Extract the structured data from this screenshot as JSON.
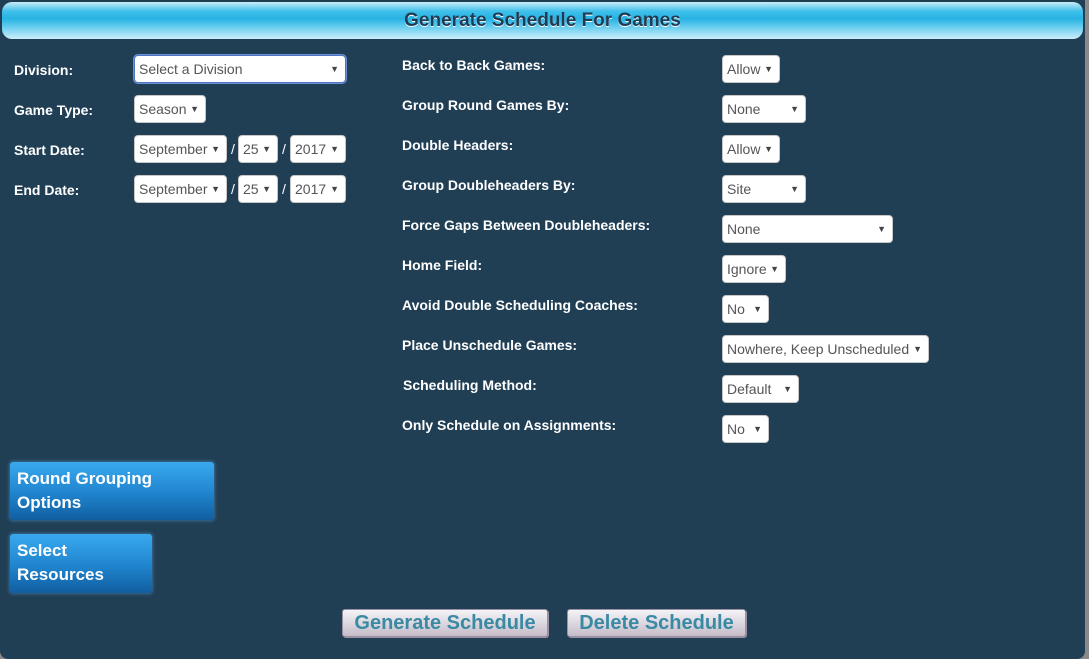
{
  "header": {
    "title": "Generate Schedule For Games"
  },
  "left_form": {
    "division": {
      "label": "Division:",
      "value": "Select a Division"
    },
    "game_type": {
      "label": "Game Type:",
      "value": "Season"
    },
    "start_date": {
      "label": "Start Date:",
      "month": "September",
      "day": "25",
      "year": "2017"
    },
    "end_date": {
      "label": "End Date:",
      "month": "September",
      "day": "25",
      "year": "2017"
    },
    "date_separator": "/"
  },
  "right_form": {
    "fields": [
      {
        "label": "Back to Back Games:",
        "value": "Allow"
      },
      {
        "label": "Group Round Games By:",
        "value": "None"
      },
      {
        "label": "Double Headers:",
        "value": "Allow"
      },
      {
        "label": "Group Doubleheaders By:",
        "value": "Site"
      },
      {
        "label": "Force Gaps Between Doubleheaders:",
        "value": "None"
      },
      {
        "label": "Home Field:",
        "value": "Ignore"
      },
      {
        "label": "Avoid Double Scheduling Coaches:",
        "value": "No"
      },
      {
        "label": "Place Unschedule Games:",
        "value": "Nowhere, Keep Unscheduled"
      },
      {
        "label": "Scheduling Method:",
        "value": "Default"
      },
      {
        "label": "Only Schedule on Assignments:",
        "value": "No"
      }
    ]
  },
  "side_buttons": {
    "round_grouping": {
      "line1": "Round Grouping",
      "line2": "Options"
    },
    "select_resources": {
      "line1": "Select",
      "line2": "Resources"
    }
  },
  "actions": {
    "generate_label": "Generate Schedule",
    "delete_label": "Delete Schedule"
  },
  "icons": {
    "dropdown_arrow": "▼"
  }
}
